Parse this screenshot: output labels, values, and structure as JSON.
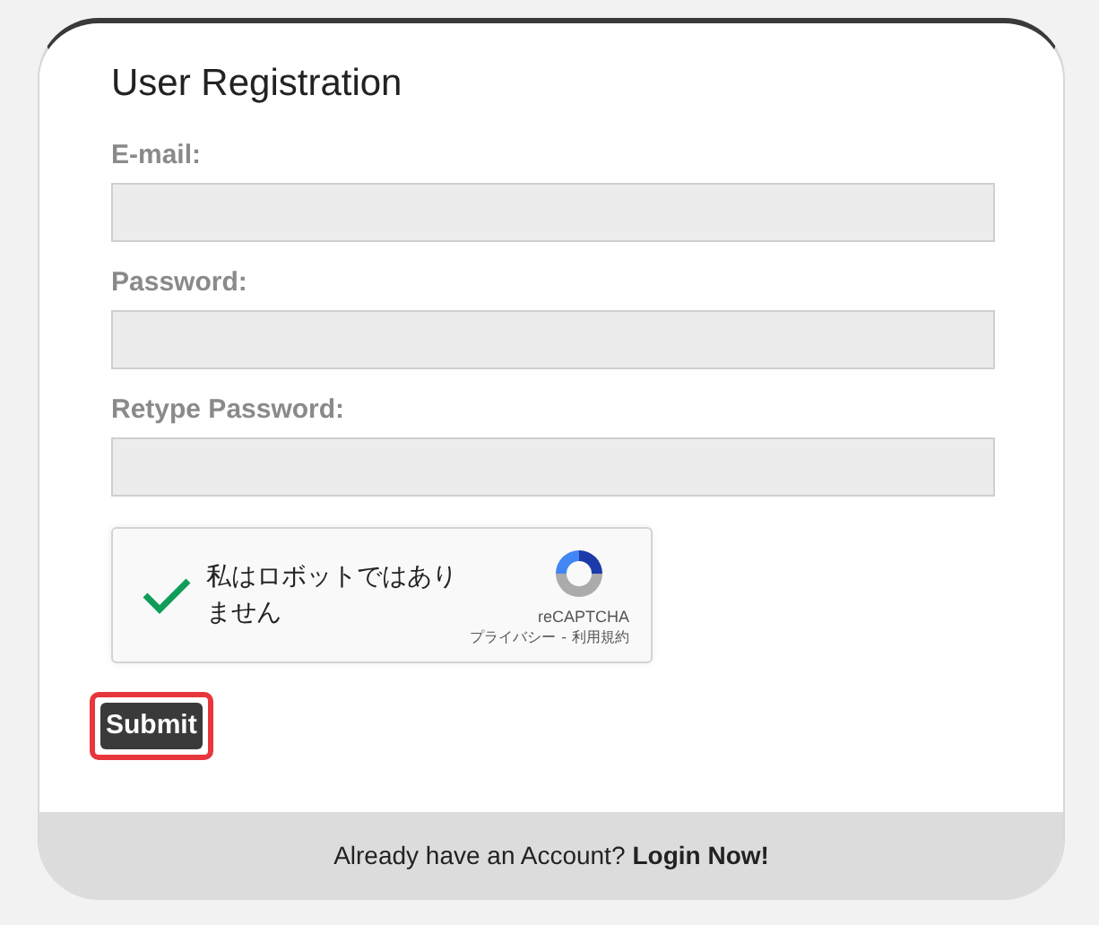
{
  "title": "User Registration",
  "fields": [
    {
      "label": "E-mail:"
    },
    {
      "label": "Password:"
    },
    {
      "label": "Retype Password:"
    }
  ],
  "captcha": {
    "text": "私はロボットではありません",
    "checked": true,
    "brand": "reCAPTCHA",
    "privacy": "プライバシー",
    "separator": "-",
    "terms": "利用規約"
  },
  "submit": {
    "label": "Submit",
    "focused": true
  },
  "footer": {
    "text": "Already have an Account?",
    "link": "Login Now!"
  }
}
